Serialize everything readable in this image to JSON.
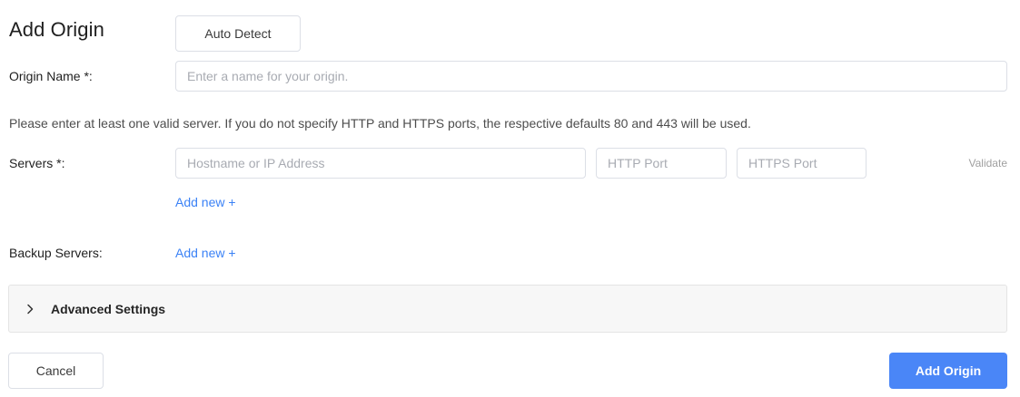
{
  "header": {
    "title": "Add Origin",
    "auto_detect_label": "Auto Detect"
  },
  "origin_name": {
    "label": "Origin Name *:",
    "value": "",
    "placeholder": "Enter a name for your origin."
  },
  "hint_text": "Please enter at least one valid server. If you do not specify HTTP and HTTPS ports, the respective defaults 80 and 443 will be used.",
  "servers": {
    "label": "Servers *:",
    "hostname_placeholder": "Hostname or IP Address",
    "http_port_placeholder": "HTTP Port",
    "https_port_placeholder": "HTTPS Port",
    "validate_label": "Validate",
    "add_new_label": "Add new +"
  },
  "backup_servers": {
    "label": "Backup Servers:",
    "add_new_label": "Add new +"
  },
  "advanced": {
    "label": "Advanced Settings",
    "icon": "chevron-right-icon",
    "expanded": false
  },
  "footer": {
    "cancel_label": "Cancel",
    "submit_label": "Add Origin"
  },
  "colors": {
    "accent": "#4a86f7",
    "link": "#3b82f6",
    "border": "#dcdfe6",
    "panel_bg": "#f7f7f7"
  }
}
